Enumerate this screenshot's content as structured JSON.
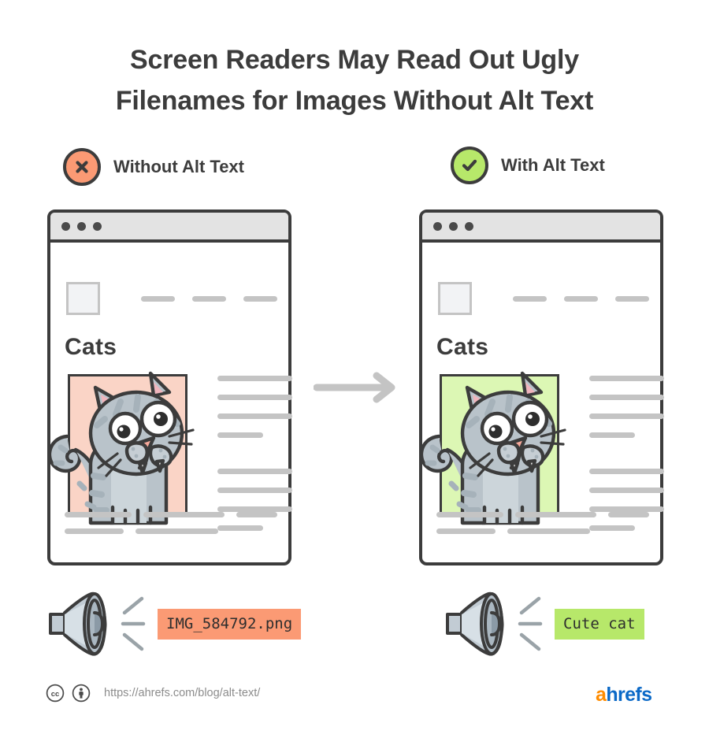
{
  "title": {
    "line1": "Screen Readers May Read Out Ugly",
    "line2": "Filenames for Images Without Alt Text"
  },
  "columns": {
    "left": {
      "badge_icon": "x-circle-icon",
      "label": "Without Alt Text",
      "badge_color": "#fb9a74",
      "image_frame_color": "#fad4c6",
      "screen_reader_output": "IMG_584792.png",
      "highlight_color": "#fb9a74"
    },
    "right": {
      "badge_icon": "check-circle-icon",
      "label": "With Alt Text",
      "badge_color": "#b7e86a",
      "image_frame_color": "#dcf7b4",
      "screen_reader_output": "Cute cat",
      "highlight_color": "#b7e86a"
    }
  },
  "browser": {
    "page_heading": "Cats",
    "nav_link_count": 3,
    "titlebar_dot_count": 3,
    "paragraph_groups": [
      {
        "full_lines": 3,
        "short_line": true
      },
      {
        "full_lines": 3,
        "short_line": true
      }
    ],
    "bottom_rows": [
      [
        98,
        118,
        60
      ],
      [
        75,
        105
      ]
    ]
  },
  "arrow": {
    "icon": "arrow-right-icon",
    "color": "#c4c4c4"
  },
  "speaker": {
    "icon": "speaker-icon",
    "sound_lines": 3
  },
  "footer": {
    "license_icons": [
      "creative-commons-icon",
      "creative-commons-by-icon"
    ],
    "url": "https://ahrefs.com/blog/alt-text/"
  },
  "brand": {
    "accent_letter": "a",
    "rest": "hrefs",
    "accent_color": "#ff8c00",
    "text_color": "#0b69c7"
  }
}
